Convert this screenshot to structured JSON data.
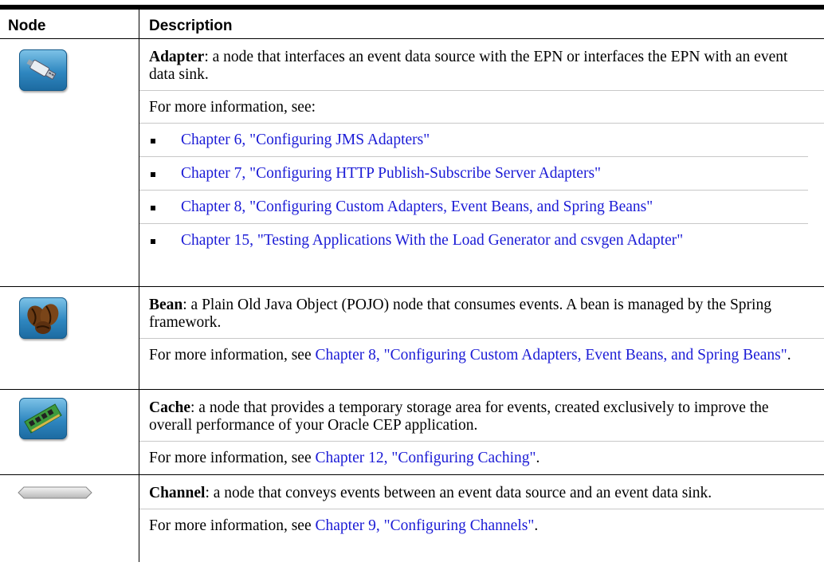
{
  "header": {
    "col_node": "Node",
    "col_desc": "Description"
  },
  "rows": [
    {
      "icon": "usb-adapter-icon",
      "term": "Adapter",
      "text": ": a node that interfaces an event data source with the EPN or interfaces the EPN with an event data sink.",
      "more": "For more information, see:",
      "links": [
        "Chapter 6, \"Configuring JMS Adapters\"",
        "Chapter 7, \"Configuring HTTP Publish-Subscribe Server Adapters\"",
        "Chapter 8, \"Configuring Custom Adapters, Event Beans, and Spring Beans\"",
        "Chapter 15, \"Testing Applications With the Load Generator and csvgen Adapter\""
      ]
    },
    {
      "icon": "coffee-beans-icon",
      "term": "Bean",
      "text": ": a Plain Old Java Object (POJO) node that consumes events. A bean is managed by the Spring framework.",
      "more_prefix": "For more information, see ",
      "more_link": "Chapter 8, \"Configuring Custom Adapters, Event Beans, and Spring Beans\"",
      "more_suffix": "."
    },
    {
      "icon": "memory-chip-icon",
      "term": "Cache",
      "text": ": a node that provides a temporary storage area for events, created exclusively to improve the overall performance of your Oracle CEP application.",
      "more_prefix": "For more information, see ",
      "more_link": "Chapter 12, \"Configuring Caching\"",
      "more_suffix": "."
    },
    {
      "icon": "channel-pipe-icon",
      "term": "Channel",
      "text": ": a node that conveys events between an event data source and an event data sink.",
      "more_prefix": "For more information, see ",
      "more_link": "Chapter 9, \"Configuring Channels\"",
      "more_suffix": "."
    }
  ]
}
